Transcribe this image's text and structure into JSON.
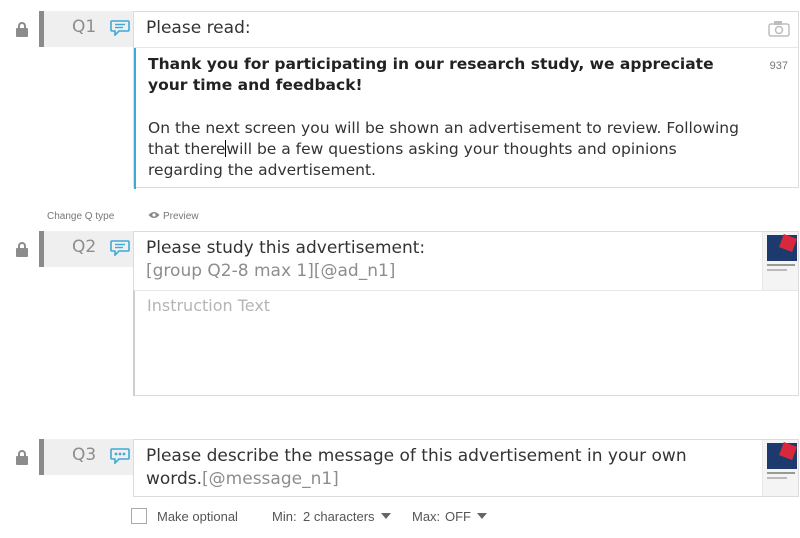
{
  "q1": {
    "number": "Q1",
    "title": "Please read:",
    "bold_text": "Thank you for participating in our research study, we appreciate your time and feedback!",
    "body_before_cursor": "On the next screen you will be shown an advertisement to review.  Following that there",
    "body_after_cursor": "will be a few questions asking your thoughts and opinions regarding the advertisement.",
    "char_count": "937"
  },
  "links": {
    "change_q_type": "Change Q type",
    "preview": "Preview"
  },
  "q2": {
    "number": "Q2",
    "title": "Please study this advertisement:",
    "code": "[group Q2-8 max 1][@ad_n1]",
    "instruction_placeholder": "Instruction Text"
  },
  "q3": {
    "number": "Q3",
    "title": "Please describe the message of this advertisement in your own words.",
    "code": "[@message_n1]"
  },
  "options": {
    "make_optional": "Make optional",
    "min_label": "Min:",
    "min_value": "2 characters",
    "max_label": "Max:",
    "max_value": "OFF"
  },
  "colors": {
    "accent": "#3fa9d8",
    "tab_bar": "#8a8a8a",
    "tab_bg": "#efefef"
  },
  "icons": {
    "lock": "lock-icon",
    "comment": "speech-bubble-icon",
    "camera": "camera-icon",
    "eye": "eye-icon"
  }
}
